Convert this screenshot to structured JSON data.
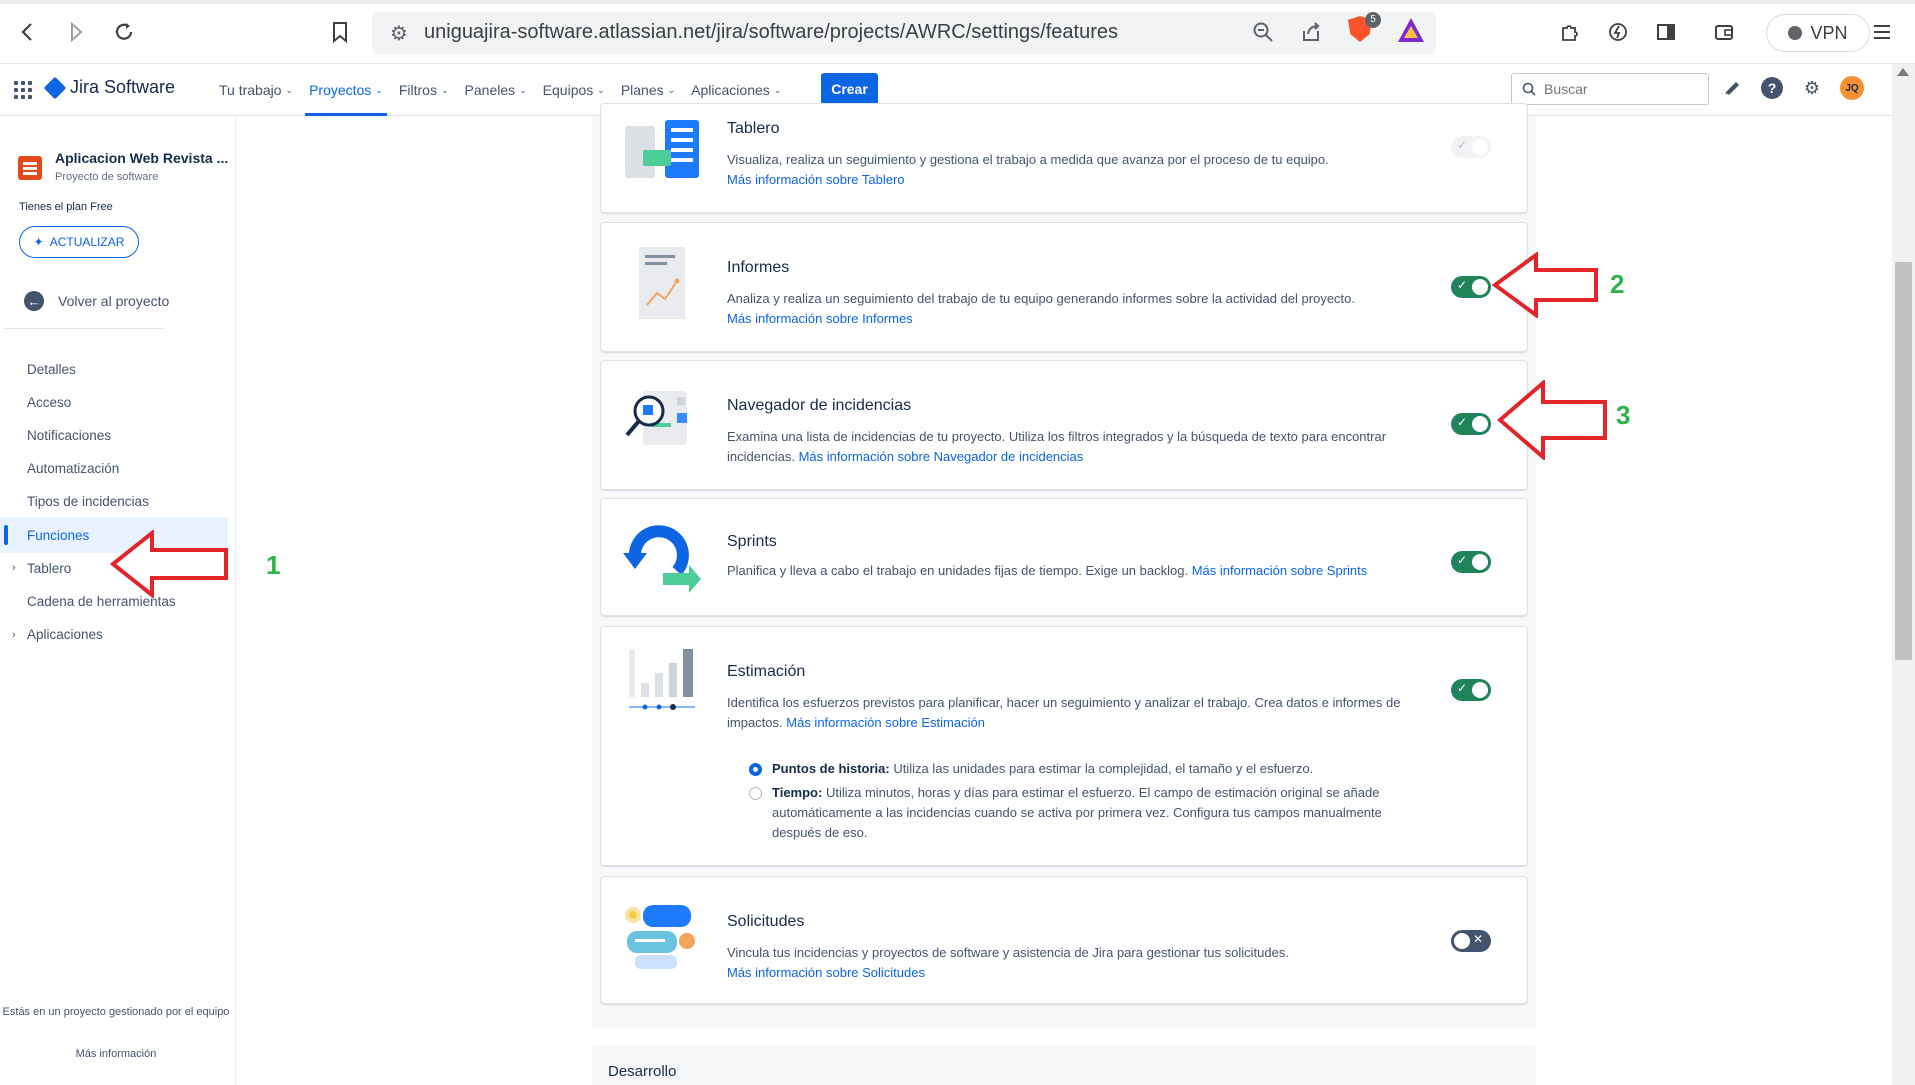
{
  "browser": {
    "url": "uniguajira-software.atlassian.net/jira/software/projects/AWRC/settings/features",
    "brave_badge": "5",
    "vpn_label": "VPN",
    "icons": [
      "back-icon",
      "forward-icon",
      "reload-icon",
      "bookmark-icon",
      "site-settings-icon",
      "zoom-icon",
      "share-icon",
      "brave-shield-icon",
      "brave-rewards-icon",
      "extensions-icon",
      "leo-icon",
      "sidebar-icon",
      "wallet-icon",
      "menu-icon"
    ]
  },
  "jira_nav": {
    "app_name": "Jira Software",
    "items": [
      {
        "label": "Tu trabajo",
        "active": false
      },
      {
        "label": "Proyectos",
        "active": true
      },
      {
        "label": "Filtros",
        "active": false
      },
      {
        "label": "Paneles",
        "active": false
      },
      {
        "label": "Equipos",
        "active": false
      },
      {
        "label": "Planes",
        "active": false
      },
      {
        "label": "Aplicaciones",
        "active": false
      }
    ],
    "create_label": "Crear",
    "search_placeholder": "Buscar",
    "avatar_initials": "JQ"
  },
  "sidebar": {
    "project_name": "Aplicacion Web Revista ...",
    "project_type": "Proyecto de software",
    "plan_text": "Tienes el plan Free",
    "upgrade_label": "ACTUALIZAR",
    "back_label": "Volver al proyecto",
    "items": [
      {
        "label": "Detalles",
        "active": false,
        "expandable": false
      },
      {
        "label": "Acceso",
        "active": false,
        "expandable": false
      },
      {
        "label": "Notificaciones",
        "active": false,
        "expandable": false
      },
      {
        "label": "Automatización",
        "active": false,
        "expandable": false
      },
      {
        "label": "Tipos de incidencias",
        "active": false,
        "expandable": false
      },
      {
        "label": "Funciones",
        "active": true,
        "expandable": false
      },
      {
        "label": "Tablero",
        "active": false,
        "expandable": true
      },
      {
        "label": "Cadena de herramientas",
        "active": false,
        "expandable": false
      },
      {
        "label": "Aplicaciones",
        "active": false,
        "expandable": true
      }
    ],
    "footer_text": "Estás en un proyecto gestionado por el equipo",
    "footer_link": "Más información"
  },
  "features": [
    {
      "key": "tablero",
      "title": "Tablero",
      "desc": "Visualiza, realiza un seguimiento y gestiona el trabajo a medida que avanza por el proceso de tu equipo.",
      "link": "Más información sobre Tablero",
      "state": "disabled"
    },
    {
      "key": "informes",
      "title": "Informes",
      "desc": "Analiza y realiza un seguimiento del trabajo de tu equipo generando informes sobre la actividad del proyecto.",
      "link": "Más información sobre Informes",
      "state": "on"
    },
    {
      "key": "navegador",
      "title": "Navegador de incidencias",
      "desc": "Examina una lista de incidencias de tu proyecto. Utiliza los filtros integrados y la búsqueda de texto para encontrar incidencias.",
      "link": "Más información sobre Navegador de incidencias",
      "state": "on"
    },
    {
      "key": "sprints",
      "title": "Sprints",
      "desc": "Planifica y lleva a cabo el trabajo en unidades fijas de tiempo. Exige un backlog.",
      "link": "Más información sobre Sprints",
      "state": "on"
    },
    {
      "key": "estimacion",
      "title": "Estimación",
      "desc": "Identifica los esfuerzos previstos para planificar, hacer un seguimiento y analizar el trabajo. Crea datos e informes de impactos.",
      "link": "Más información sobre Estimación",
      "state": "on"
    },
    {
      "key": "solicitudes",
      "title": "Solicitudes",
      "desc": "Vincula tus incidencias y proyectos de software y asistencia de Jira para gestionar tus solicitudes.",
      "link": "Más información sobre Solicitudes",
      "state": "off"
    }
  ],
  "estimation_options": [
    {
      "label": "Puntos de historia:",
      "text": "Utiliza las unidades para estimar la complejidad, el tamaño y el esfuerzo.",
      "checked": true
    },
    {
      "label": "Tiempo:",
      "text": "Utiliza minutos, horas y días para estimar el esfuerzo. El campo de estimación original se añade automáticamente a las incidencias cuando se activa por primera vez. Configura tus campos manualmente después de eso.",
      "checked": false
    }
  ],
  "section_dev": "Desarrollo",
  "annotations": {
    "n1": "1",
    "n2": "2",
    "n3": "3",
    "arrow_color": "#e3242b",
    "number_color": "#2db34a"
  }
}
